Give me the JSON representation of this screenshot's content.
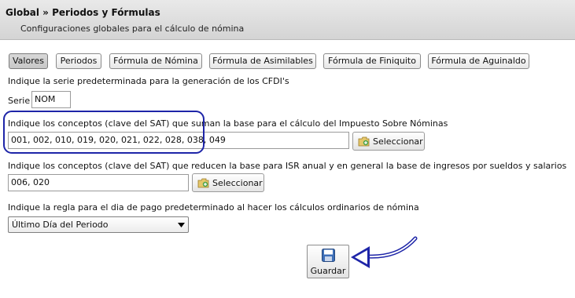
{
  "header": {
    "title": "Global » Periodos y Fórmulas",
    "subtitle": "Configuraciones globales para el cálculo de nómina"
  },
  "tabs": [
    {
      "label": "Valores",
      "active": true
    },
    {
      "label": "Periodos",
      "active": false
    },
    {
      "label": "Fórmula de Nómina",
      "active": false
    },
    {
      "label": "Fórmula de Asimilables",
      "active": false
    },
    {
      "label": "Fórmula de Finiquito",
      "active": false
    },
    {
      "label": "Fórmula de Aguinaldo",
      "active": false
    }
  ],
  "serie": {
    "instruction": "Indique la serie predeterminada para la generación de los CFDI's",
    "label": "Serie",
    "value": "NOM"
  },
  "suman": {
    "instruction": "Indique los conceptos (clave del SAT) que suman la base para el cálculo del Impuesto Sobre Nóminas",
    "value": "001, 002, 010, 019, 020, 021, 022, 028, 038, 049",
    "button_label": "Seleccionar"
  },
  "reducen": {
    "instruction": "Indique los conceptos (clave del SAT) que reducen la base para ISR anual y en general la base de ingresos por sueldos y salarios",
    "value": "006, 020",
    "button_label": "Seleccionar"
  },
  "regla": {
    "instruction": "Indique la regla para el dia de pago predeterminado al hacer los cálculos ordinarios de nómina",
    "selected": "Último Día del Periodo"
  },
  "save_label": "Guardar",
  "colors": {
    "highlight": "#1e25a8",
    "arrow": "#1e25a8",
    "header_bg": "#d9d9d9"
  },
  "icons": {
    "select_button": "add-folder-icon",
    "save_button": "floppy-disk-icon",
    "dropdown": "chevron-down-icon"
  }
}
